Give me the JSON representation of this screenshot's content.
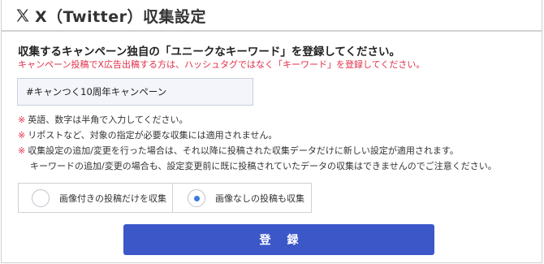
{
  "header": {
    "title": "X（Twitter）収集設定",
    "logo_icon": "x-logo-icon"
  },
  "form": {
    "instruction": "収集するキャンペーン独自の「ユニークなキーワード」を登録してください。",
    "warning": "キャンペーン投稿でX広告出稿する方は、ハッシュタグではなく「キーワード」を登録してください。",
    "keyword_value": "#キャンつく10周年キャンペーン",
    "note_mark": "※",
    "notes": [
      "英語、数字は半角で入力してください。",
      "リポストなど、対象の指定が必要な収集には適用されません。",
      "収集設定の追加/変更を行った場合は、それ以降に投稿された収集データだけに新しい設定が適用されます。"
    ],
    "note_continuation": "キーワードの追加/変更の場合も、設定変更前に既に投稿されていたデータの収集はできませんのでご注意ください。",
    "radio_options": [
      {
        "label": "画像付きの投稿だけを収集",
        "selected": false
      },
      {
        "label": "画像なしの投稿も収集",
        "selected": true
      }
    ],
    "submit_label": "登録"
  },
  "colors": {
    "accent_button": "#3c57c8",
    "warning_text": "#e0304a",
    "radio_selected": "#3d7bd8"
  }
}
